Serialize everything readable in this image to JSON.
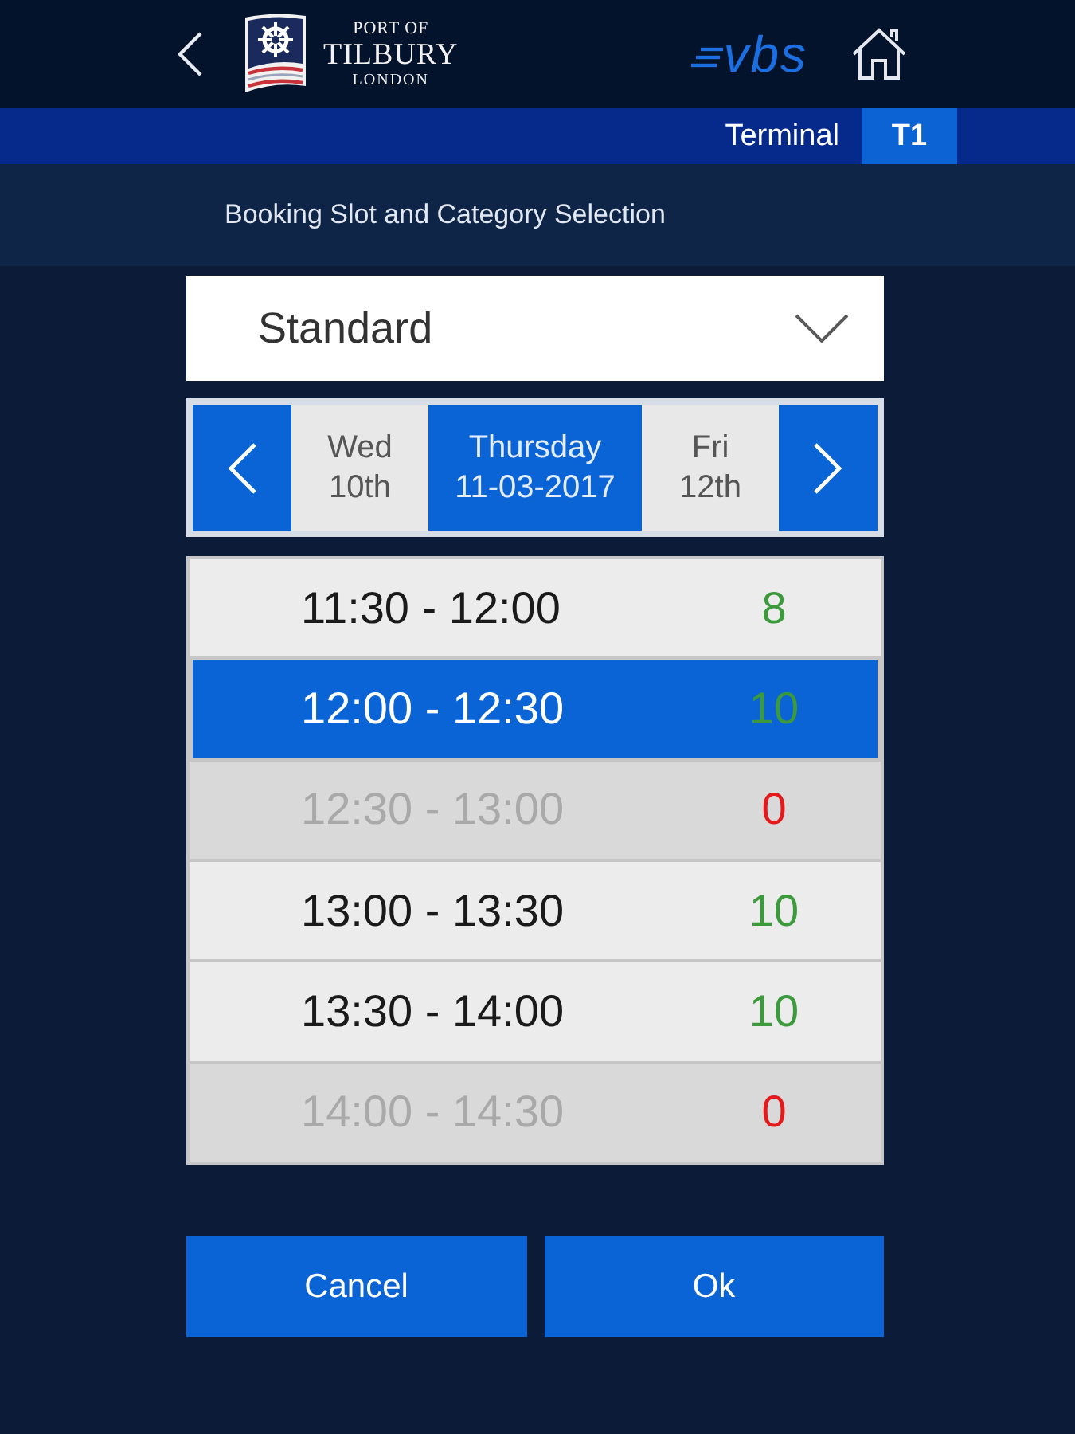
{
  "header": {
    "logo": {
      "line_1": "PORT OF",
      "line_2": "TILBURY",
      "line_3": "LONDON"
    },
    "brand": "vbs"
  },
  "terminal": {
    "label": "Terminal",
    "value": "T1"
  },
  "page_title": "Booking Slot and Category Selection",
  "category": {
    "value": "Standard"
  },
  "days": [
    {
      "weekday": "Wed",
      "date": "10th",
      "selected": false
    },
    {
      "weekday": "Thursday",
      "date": "11-03-2017",
      "selected": true
    },
    {
      "weekday": "Fri",
      "date": "12th",
      "selected": false
    }
  ],
  "slots": [
    {
      "time": "11:30 - 12:00",
      "count": "8",
      "selected": false,
      "disabled": false
    },
    {
      "time": "12:00 - 12:30",
      "count": "10",
      "selected": true,
      "disabled": false
    },
    {
      "time": "12:30 - 13:00",
      "count": "0",
      "selected": false,
      "disabled": true
    },
    {
      "time": "13:00 - 13:30",
      "count": "10",
      "selected": false,
      "disabled": false
    },
    {
      "time": "13:30 - 14:00",
      "count": "10",
      "selected": false,
      "disabled": false
    },
    {
      "time": "14:00 - 14:30",
      "count": "0",
      "selected": false,
      "disabled": true
    }
  ],
  "buttons": [
    {
      "label": "Cancel"
    },
    {
      "label": "Ok"
    }
  ]
}
